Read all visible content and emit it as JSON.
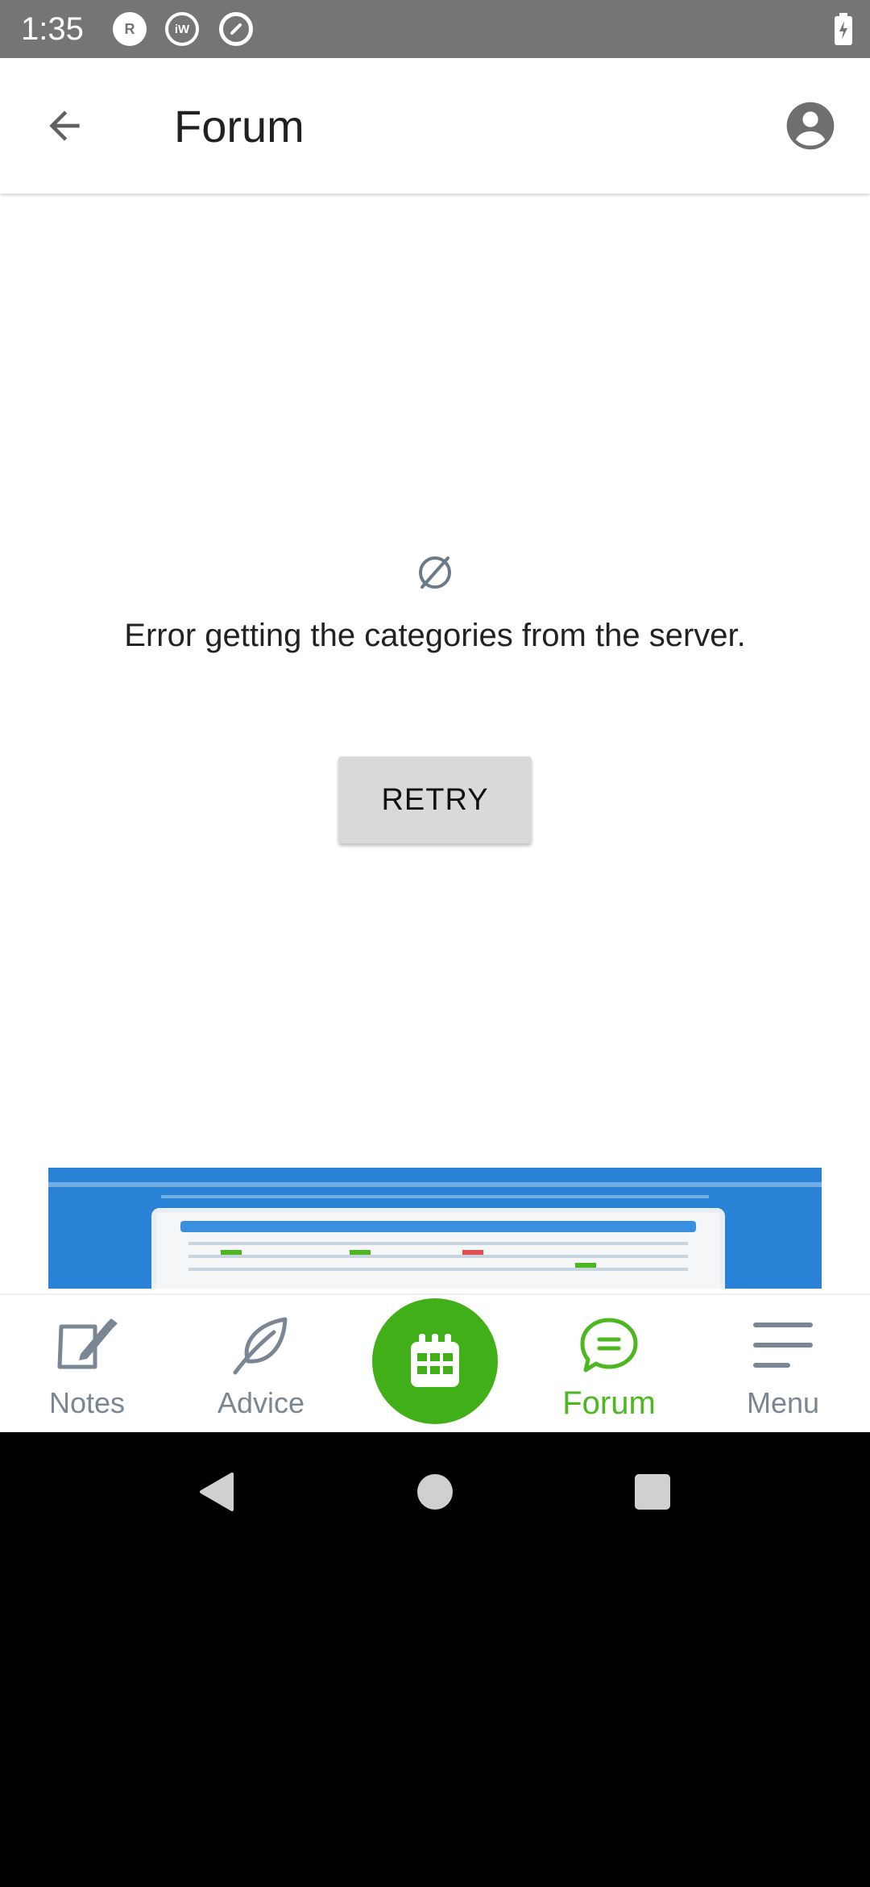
{
  "status_bar": {
    "time": "1:35",
    "icons": [
      "r-notification-icon",
      "iw-notification-icon",
      "q-notification-icon",
      "battery-charging-icon"
    ],
    "r_label": "R",
    "iw_label": "iW"
  },
  "app_bar": {
    "title": "Forum",
    "back_icon": "arrow-back-icon",
    "account_icon": "account-circle-icon"
  },
  "error": {
    "icon": "empty-set-icon",
    "message": "Error getting the categories from the server.",
    "retry_label": "RETRY"
  },
  "ad": {
    "description_icon": "advertisement-banner"
  },
  "bottom_nav": {
    "items": [
      {
        "label": "Notes",
        "icon": "notes-edit-icon",
        "active": false
      },
      {
        "label": "Advice",
        "icon": "leaf-icon",
        "active": false
      },
      {
        "label": "Forum",
        "icon": "chat-bubble-icon",
        "active": true
      },
      {
        "label": "Menu",
        "icon": "hamburger-menu-icon",
        "active": false
      }
    ],
    "center_button_icon": "calendar-icon"
  },
  "colors": {
    "accent_green": "#41b018",
    "active_label": "#4cb71f",
    "inactive_label": "#7a8694",
    "status_bar": "#757575"
  }
}
